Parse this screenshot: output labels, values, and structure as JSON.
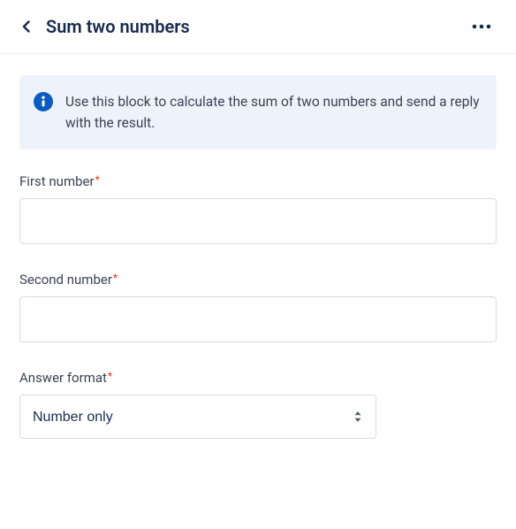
{
  "header": {
    "title": "Sum two numbers"
  },
  "info": {
    "text": "Use this block to calculate the sum of two numbers and send a reply with the result."
  },
  "fields": {
    "first": {
      "label": "First number",
      "value": ""
    },
    "second": {
      "label": "Second number",
      "value": ""
    },
    "format": {
      "label": "Answer format",
      "selected": "Number only"
    }
  }
}
